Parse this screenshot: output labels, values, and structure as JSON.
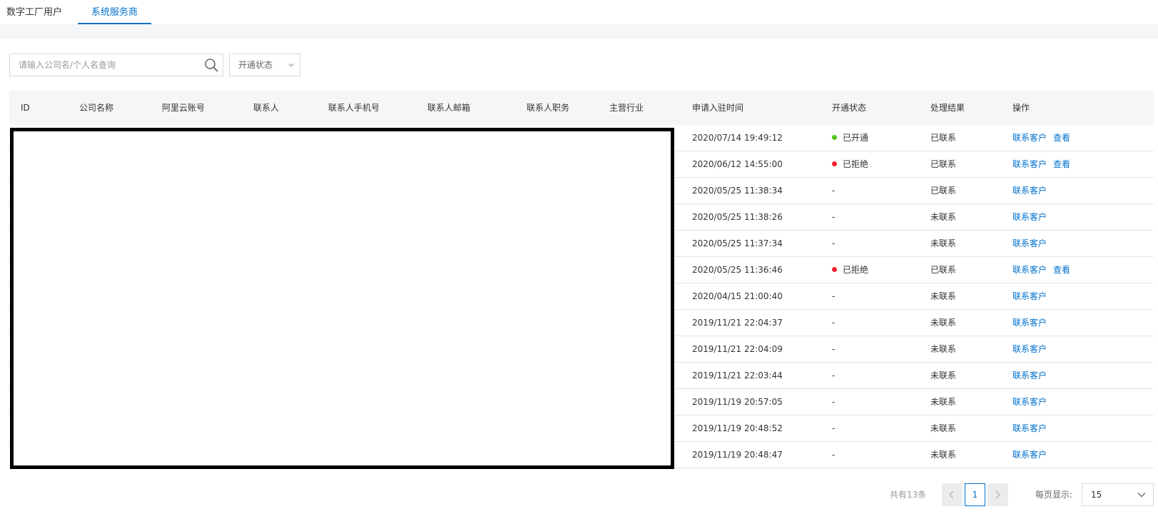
{
  "tabs": [
    {
      "label": "数字工厂用户"
    },
    {
      "label": "系统服务商"
    }
  ],
  "search": {
    "placeholder": "请输入公司名/个人名查询",
    "icon": "search-icon"
  },
  "status_filter": {
    "label": "开通状态"
  },
  "table": {
    "columns": [
      "ID",
      "公司名称",
      "阿里云账号",
      "联系人",
      "联系人手机号",
      "联系人邮箱",
      "联系人职务",
      "主营行业",
      "申请入驻时间",
      "开通状态",
      "处理结果",
      "操作"
    ],
    "rows": [
      {
        "time": "2020/07/14 19:49:12",
        "status": "已开通",
        "status_color": "#52c41a",
        "result": "已联系",
        "actions": [
          "联系客户",
          "查看"
        ]
      },
      {
        "time": "2020/06/12 14:55:00",
        "status": "已拒绝",
        "status_color": "#f5222d",
        "result": "已联系",
        "actions": [
          "联系客户",
          "查看"
        ]
      },
      {
        "time": "2020/05/25 11:38:34",
        "status": "-",
        "status_color": "",
        "result": "已联系",
        "actions": [
          "联系客户"
        ]
      },
      {
        "time": "2020/05/25 11:38:26",
        "status": "-",
        "status_color": "",
        "result": "未联系",
        "actions": [
          "联系客户"
        ]
      },
      {
        "time": "2020/05/25 11:37:34",
        "status": "-",
        "status_color": "",
        "result": "未联系",
        "actions": [
          "联系客户"
        ]
      },
      {
        "time": "2020/05/25 11:36:46",
        "status": "已拒绝",
        "status_color": "#f5222d",
        "result": "已联系",
        "actions": [
          "联系客户",
          "查看"
        ]
      },
      {
        "time": "2020/04/15 21:00:40",
        "status": "-",
        "status_color": "",
        "result": "未联系",
        "actions": [
          "联系客户"
        ]
      },
      {
        "time": "2019/11/21 22:04:37",
        "status": "-",
        "status_color": "",
        "result": "未联系",
        "actions": [
          "联系客户"
        ]
      },
      {
        "time": "2019/11/21 22:04:09",
        "status": "-",
        "status_color": "",
        "result": "未联系",
        "actions": [
          "联系客户"
        ]
      },
      {
        "time": "2019/11/21 22:03:44",
        "status": "-",
        "status_color": "",
        "result": "未联系",
        "actions": [
          "联系客户"
        ]
      },
      {
        "time": "2019/11/19 20:57:05",
        "status": "-",
        "status_color": "",
        "result": "未联系",
        "actions": [
          "联系客户"
        ]
      },
      {
        "time": "2019/11/19 20:48:52",
        "status": "-",
        "status_color": "",
        "result": "未联系",
        "actions": [
          "联系客户"
        ]
      },
      {
        "time": "2019/11/19 20:48:47",
        "status": "-",
        "status_color": "",
        "result": "未联系",
        "actions": [
          "联系客户"
        ]
      }
    ]
  },
  "pagination": {
    "total": "共有13条",
    "current_page": "1",
    "per_page_label": "每页显示:",
    "per_page_value": "15"
  },
  "colors": {
    "accent": "#0070cc",
    "success": "#52c41a",
    "danger": "#f5222d"
  }
}
